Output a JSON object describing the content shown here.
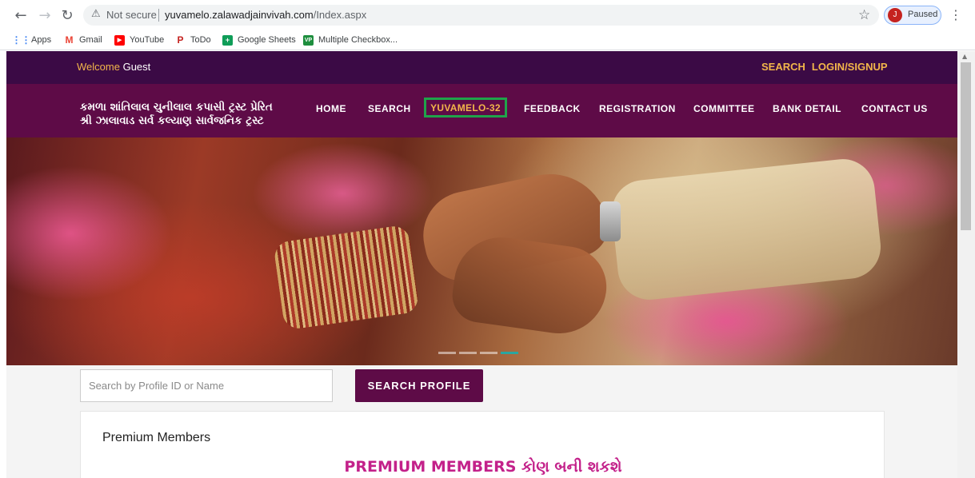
{
  "browser": {
    "address_warning": "Not secure",
    "url_domain": "yuvamelo.zalawadjainvivah.com",
    "url_path": "/Index.aspx",
    "profile_initial": "J",
    "profile_status": "Paused",
    "bookmarks": [
      {
        "label": "Apps",
        "icon": "apps-grid-icon",
        "color": "#4285f4"
      },
      {
        "label": "Gmail",
        "icon": "gmail-icon",
        "color": "#ea4335"
      },
      {
        "label": "YouTube",
        "icon": "youtube-icon",
        "color": "#ff0000"
      },
      {
        "label": "ToDo",
        "icon": "todo-icon",
        "color": "#c5221f"
      },
      {
        "label": "Google Sheets",
        "icon": "sheets-icon",
        "color": "#0f9d58"
      },
      {
        "label": "Multiple Checkbox...",
        "icon": "vp-icon",
        "color": "#1e8e3e"
      }
    ]
  },
  "topbar": {
    "welcome_label": "Welcome",
    "user": "Guest",
    "links": [
      "SEARCH",
      "LOGIN/SIGNUP"
    ]
  },
  "brand": {
    "line1": "કમળા શાંતિલાલ ચુનીલાલ કપાસી ટ્રસ્ટ પ્રેરિત",
    "line2": "શ્રી ઝાલાવાડ સર્વ કલ્યાણ સાર્વજનિક ટ્રસ્ટ"
  },
  "nav": {
    "items": [
      "HOME",
      "SEARCH",
      "YUVAMELO-32",
      "FEEDBACK",
      "REGISTRATION",
      "COMMITTEE",
      "BANK DETAIL",
      "CONTACT US"
    ],
    "active_index": 2
  },
  "search": {
    "placeholder": "Search by Profile ID or Name",
    "button_label": "SEARCH PROFILE"
  },
  "premium": {
    "title": "Premium Members",
    "heading": "PREMIUM MEMBERS કોણ બની શકશે"
  },
  "colors": {
    "topbar_bg": "#3b0a45",
    "nav_bg": "#5e0b47",
    "accent_gold": "#f2b64a",
    "active_outline": "#1fa34a",
    "heading_pink": "#c3218a"
  }
}
